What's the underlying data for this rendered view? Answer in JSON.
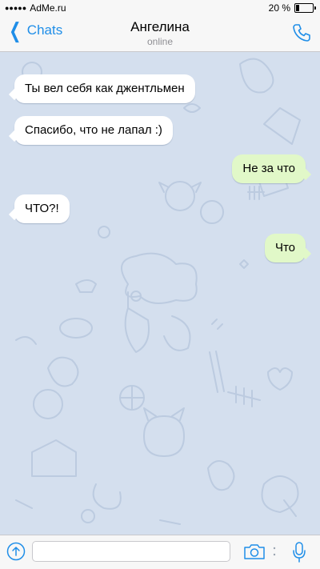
{
  "status_bar": {
    "signal": "●●●●●",
    "carrier": "AdMe.ru",
    "time": "",
    "battery_text": "20 %",
    "battery_level": 0.2
  },
  "nav": {
    "back_label": "Chats",
    "title": "Ангелина",
    "subtitle": "online"
  },
  "messages": [
    {
      "direction": "incoming",
      "text": "Ты вел себя как джентльмен"
    },
    {
      "direction": "incoming",
      "text": "Спасибо, что не лапал :)"
    },
    {
      "direction": "outgoing",
      "text": "Не за что"
    },
    {
      "direction": "incoming",
      "text": "ЧТО?!"
    },
    {
      "direction": "outgoing",
      "text": "Что"
    }
  ],
  "input": {
    "value": "",
    "placeholder": ""
  },
  "colors": {
    "accent": "#1f8ee8",
    "chat_background": "#d4dfee",
    "incoming_bubble": "#ffffff",
    "outgoing_bubble": "#e1f8c8"
  },
  "icons": {
    "back": "chevron-left-icon",
    "call": "phone-icon",
    "attach": "attach-arrow-icon",
    "camera": "camera-icon",
    "mic": "microphone-icon"
  }
}
